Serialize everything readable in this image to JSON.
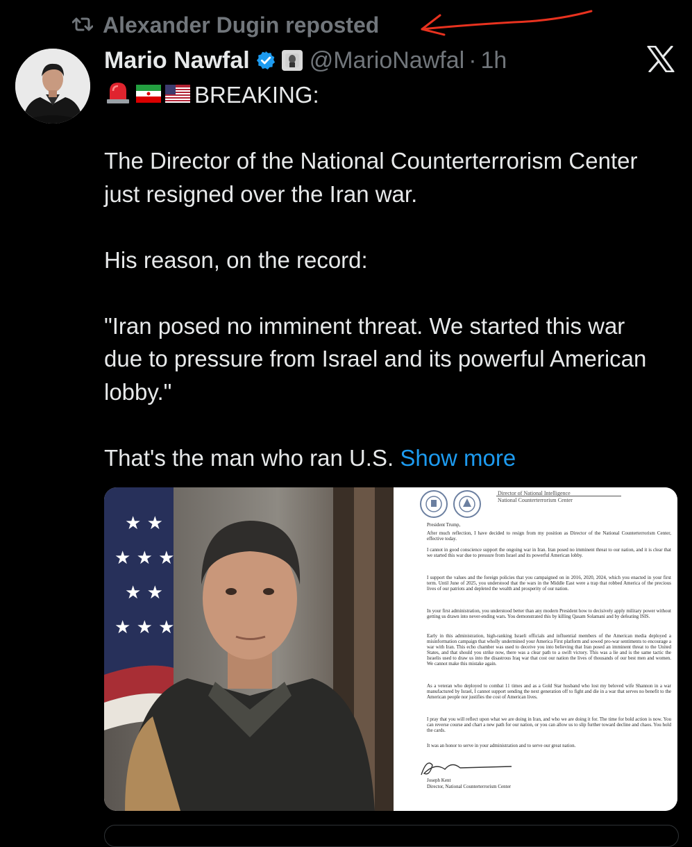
{
  "repost": {
    "label": "Alexander Dugin reposted",
    "icon": "repost-icon"
  },
  "tweet": {
    "author_name": "Mario Nawfal",
    "handle": "@MarioNawfal",
    "separator": "·",
    "time": "1h",
    "lead": "BREAKING:",
    "lead_emojis": [
      "🚨",
      "🇮🇷",
      "🇺🇸"
    ],
    "paragraphs": {
      "p1": "The Director of the National Counterterrorism Center just resigned over the Iran war.",
      "p2": "His reason, on the record:",
      "p3": "\"Iran posed no imminent threat. We started this war due to pressure from Israel and its powerful American lobby.\"",
      "p4": "That's the man who ran U.S."
    },
    "show_more": "Show more"
  },
  "letter": {
    "agency_line1": "Director of National Intelligence",
    "agency_line2": "National Counterterrorism Center",
    "salutation": "President Trump,",
    "paragraphs": {
      "p1": "After much reflection, I have decided to resign from my position as Director of the National Counterterrorism Center, effective today.",
      "p2": "I cannot in good conscience support the ongoing war in Iran. Iran posed no imminent threat to our nation, and it is clear that we started this war due to pressure from Israel and its powerful American lobby.",
      "p3": "I support the values and the foreign policies that you campaigned on in 2016, 2020, 2024, which you enacted in your first term. Until June of 2025, you understood that the wars in the Middle East were a trap that robbed America of the precious lives of our patriots and depleted the wealth and prosperity of our nation.",
      "p4": "In your first administration, you understood better than any modern President how to decisively apply military power without getting us drawn into never-ending wars. You demonstrated this by killing Qasam Solamani and by defeating ISIS.",
      "p5": "Early in this administration, high-ranking Israeli officials and influential members of the American media deployed a misinformation campaign that wholly undermined your America First platform and sowed pro-war sentiments to encourage a war with Iran. This echo chamber was used to deceive you into believing that Iran posed an imminent threat to the United States, and that should you strike now, there was a clear path to a swift victory. This was a lie and is the same tactic the Israelis used to draw us into the disastrous Iraq war that cost our nation the lives of thousands of our best men and women. We cannot make this mistake again.",
      "p6": "As a veteran who deployed to combat 11 times and as a Gold Star husband who lost my beloved wife Shannon in a war manufactured by Israel, I cannot support sending the next generation off to fight and die in a war that serves no benefit to the American people nor justifies the cost of American lives.",
      "p7": "I pray that you will reflect upon what we are doing in Iran, and who we are doing it for. The time for bold action is now. You can reverse course and chart a new path for our nation, or you can allow us to slip further toward decline and chaos. You hold the cards.",
      "p8": "It was an honor to serve in your administration and to serve our great nation."
    },
    "signer_name": "Joseph Kent",
    "signer_title": "Director, National Counterterrorism Center"
  },
  "colors": {
    "background": "#000000",
    "text": "#e7e9ea",
    "muted": "#71767b",
    "link": "#1d9bf0",
    "verified": "#1d9bf0",
    "annotation": "#e8321f"
  }
}
